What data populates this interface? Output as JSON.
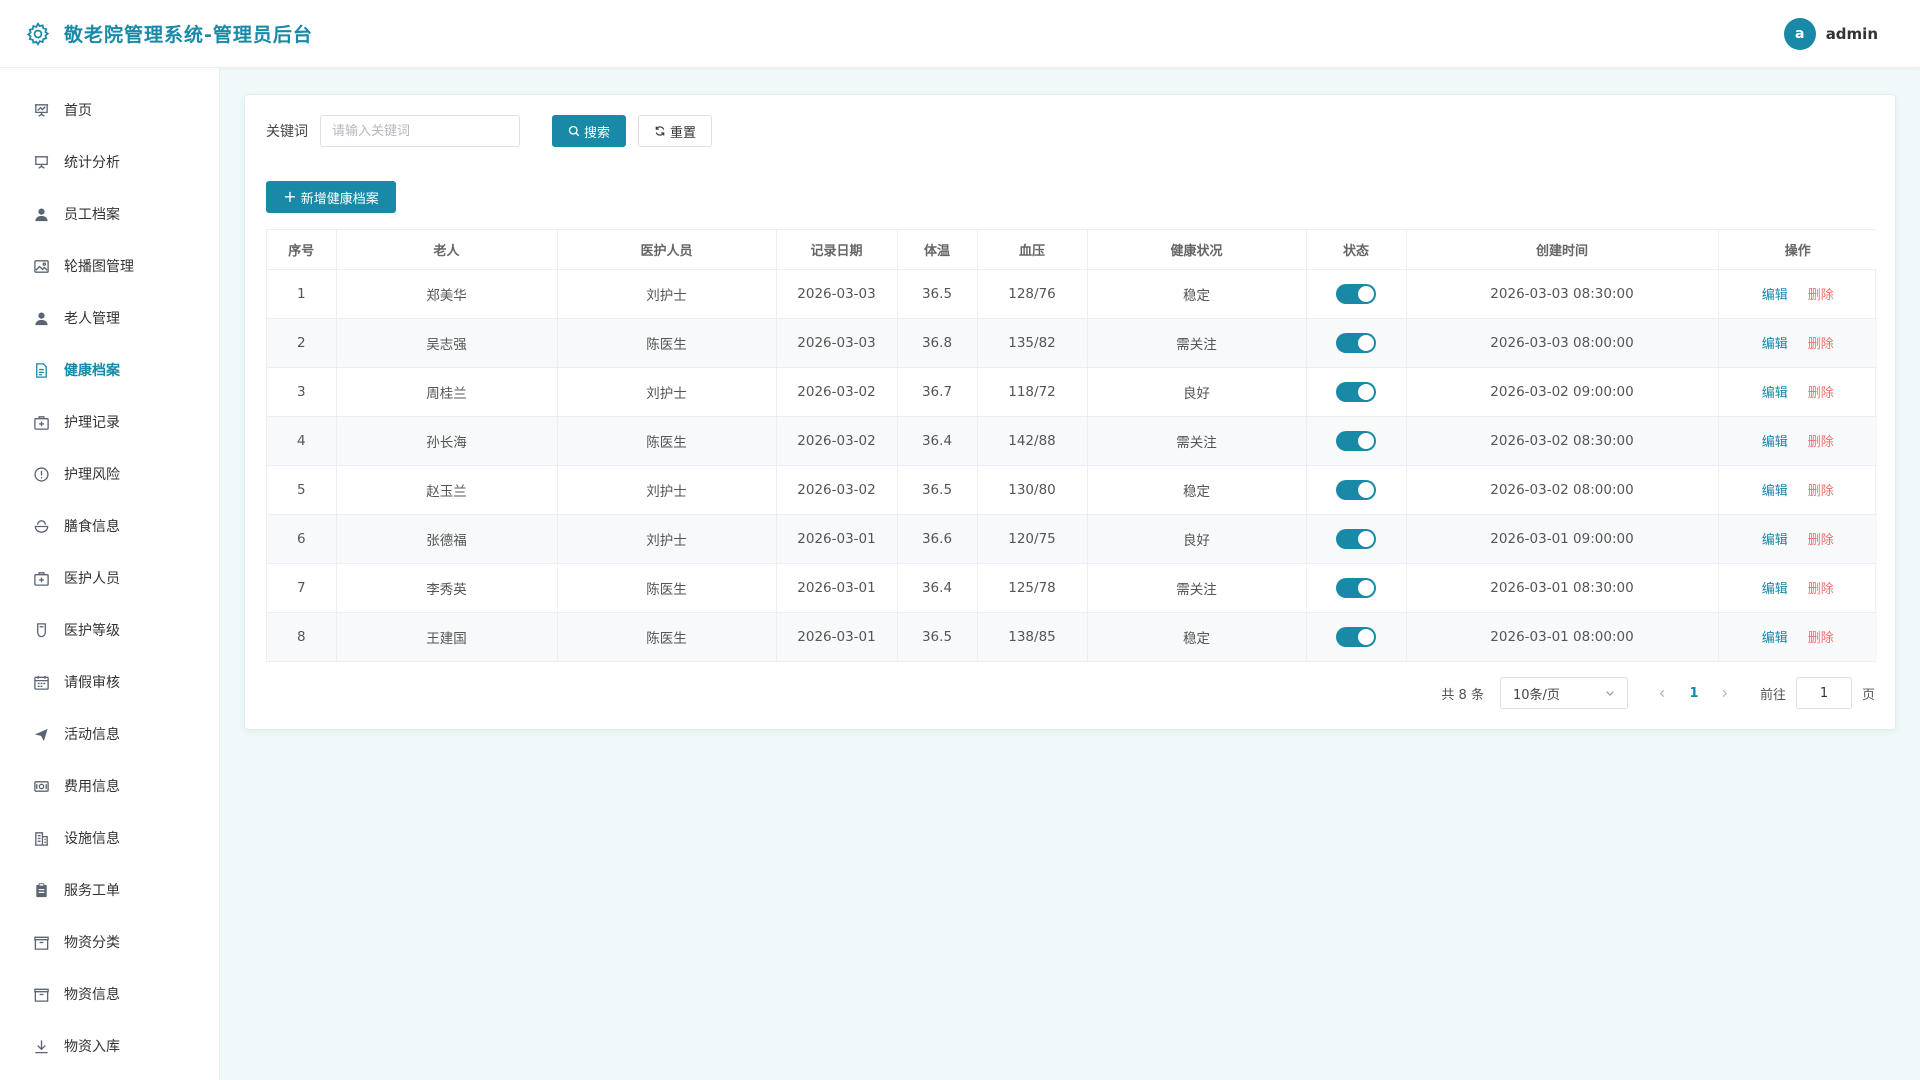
{
  "header": {
    "app_title": "敬老院管理系统-管理员后台",
    "user_initial": "a",
    "username": "admin"
  },
  "colors": {
    "primary": "#1889a6",
    "danger": "#f56c6c",
    "background": "#f0f9f9"
  },
  "sidebar": {
    "items": [
      {
        "label": "首页",
        "icon": "presentation-chart-icon"
      },
      {
        "label": "统计分析",
        "icon": "presentation-board-icon"
      },
      {
        "label": "员工档案",
        "icon": "user-icon"
      },
      {
        "label": "轮播图管理",
        "icon": "picture-icon"
      },
      {
        "label": "老人管理",
        "icon": "user-icon"
      },
      {
        "label": "健康档案",
        "icon": "document-icon",
        "active": true
      },
      {
        "label": "护理记录",
        "icon": "first-aid-kit-icon"
      },
      {
        "label": "护理风险",
        "icon": "warning-circle-icon"
      },
      {
        "label": "膳食信息",
        "icon": "bowl-icon"
      },
      {
        "label": "医护人员",
        "icon": "first-aid-kit-icon"
      },
      {
        "label": "医护等级",
        "icon": "badge-icon"
      },
      {
        "label": "请假审核",
        "icon": "calendar-icon"
      },
      {
        "label": "活动信息",
        "icon": "send-icon"
      },
      {
        "label": "费用信息",
        "icon": "money-icon"
      },
      {
        "label": "设施信息",
        "icon": "building-icon"
      },
      {
        "label": "服务工单",
        "icon": "clipboard-icon"
      },
      {
        "label": "物资分类",
        "icon": "box-icon"
      },
      {
        "label": "物资信息",
        "icon": "box-icon"
      },
      {
        "label": "物资入库",
        "icon": "download-icon"
      }
    ]
  },
  "search": {
    "label": "关键词",
    "placeholder": "请输入关键词",
    "value": "",
    "search_label": "搜索",
    "reset_label": "重置"
  },
  "toolbar": {
    "add_label": "新增健康档案"
  },
  "table": {
    "columns": [
      "序号",
      "老人",
      "医护人员",
      "记录日期",
      "体温",
      "血压",
      "健康状况",
      "状态",
      "创建时间",
      "操作"
    ],
    "edit_label": "编辑",
    "delete_label": "删除",
    "rows": [
      {
        "index": "1",
        "elder": "郑美华",
        "staff": "刘护士",
        "date": "2026-03-03",
        "temp": "36.5",
        "bp": "128/76",
        "health": "稳定",
        "status_on": true,
        "created": "2026-03-03 08:30:00"
      },
      {
        "index": "2",
        "elder": "吴志强",
        "staff": "陈医生",
        "date": "2026-03-03",
        "temp": "36.8",
        "bp": "135/82",
        "health": "需关注",
        "status_on": true,
        "created": "2026-03-03 08:00:00"
      },
      {
        "index": "3",
        "elder": "周桂兰",
        "staff": "刘护士",
        "date": "2026-03-02",
        "temp": "36.7",
        "bp": "118/72",
        "health": "良好",
        "status_on": true,
        "created": "2026-03-02 09:00:00"
      },
      {
        "index": "4",
        "elder": "孙长海",
        "staff": "陈医生",
        "date": "2026-03-02",
        "temp": "36.4",
        "bp": "142/88",
        "health": "需关注",
        "status_on": true,
        "created": "2026-03-02 08:30:00"
      },
      {
        "index": "5",
        "elder": "赵玉兰",
        "staff": "刘护士",
        "date": "2026-03-02",
        "temp": "36.5",
        "bp": "130/80",
        "health": "稳定",
        "status_on": true,
        "created": "2026-03-02 08:00:00"
      },
      {
        "index": "6",
        "elder": "张德福",
        "staff": "刘护士",
        "date": "2026-03-01",
        "temp": "36.6",
        "bp": "120/75",
        "health": "良好",
        "status_on": true,
        "created": "2026-03-01 09:00:00"
      },
      {
        "index": "7",
        "elder": "李秀英",
        "staff": "陈医生",
        "date": "2026-03-01",
        "temp": "36.4",
        "bp": "125/78",
        "health": "需关注",
        "status_on": true,
        "created": "2026-03-01 08:30:00"
      },
      {
        "index": "8",
        "elder": "王建国",
        "staff": "陈医生",
        "date": "2026-03-01",
        "temp": "36.5",
        "bp": "138/85",
        "health": "稳定",
        "status_on": true,
        "created": "2026-03-01 08:00:00"
      }
    ]
  },
  "pagination": {
    "total_text": "共 8 条",
    "page_size": "10条/页",
    "current_page": "1",
    "goto_label": "前往",
    "goto_value": "1",
    "goto_suffix": "页"
  }
}
